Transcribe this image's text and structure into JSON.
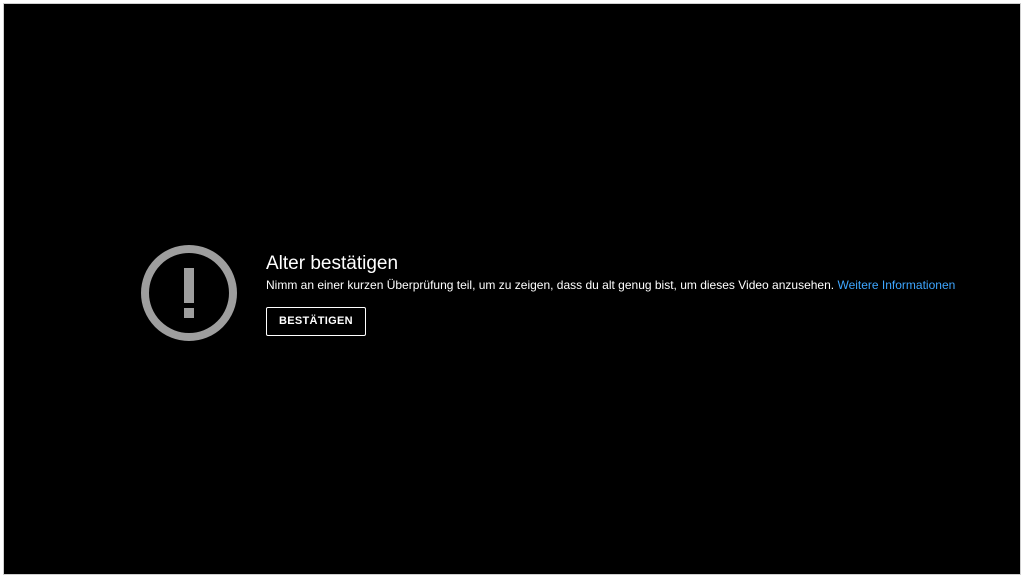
{
  "age_gate": {
    "icon": "exclamation-circle-icon",
    "title": "Alter bestätigen",
    "message": "Nimm an einer kurzen Überprüfung teil, um zu zeigen, dass du alt genug bist, um dieses Video anzusehen.",
    "learn_more_label": "Weitere Informationen",
    "confirm_button_label": "BESTÄTIGEN"
  },
  "colors": {
    "background": "#000000",
    "text": "#ffffff",
    "link": "#3ea6ff",
    "icon": "#9e9e9e"
  }
}
